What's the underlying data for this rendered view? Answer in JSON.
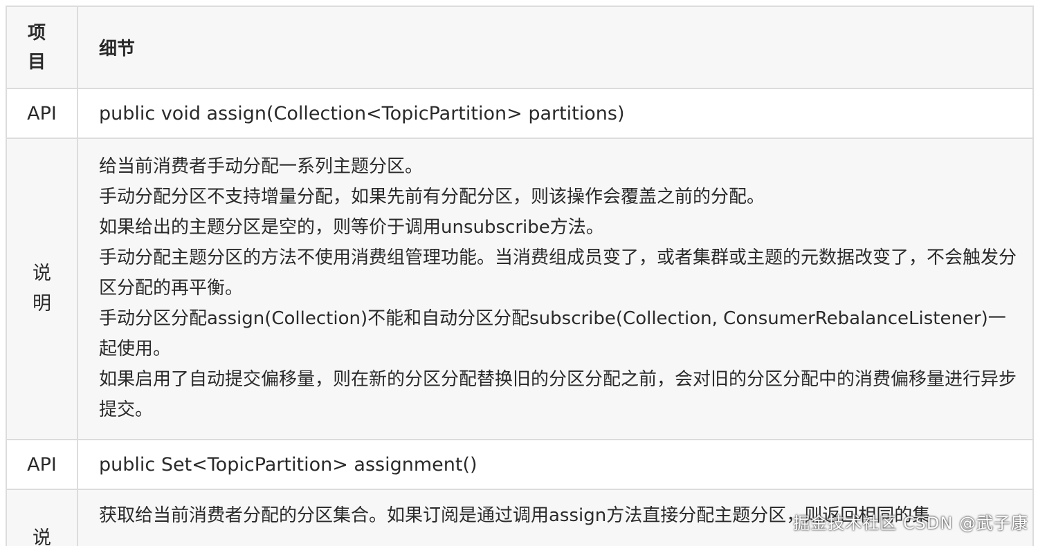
{
  "table": {
    "header": {
      "col1": [
        "项",
        "目"
      ],
      "col2": "细节"
    },
    "rows": [
      {
        "kind": "api",
        "key": "API",
        "value": "public void assign(Collection<TopicPartition> partitions)"
      },
      {
        "kind": "desc",
        "key": [
          "说",
          "明"
        ],
        "lines": [
          "给当前消费者手动分配一系列主题分区。",
          "手动分配分区不支持增量分配，如果先前有分配分区，则该操作会覆盖之前的分配。",
          "如果给出的主题分区是空的，则等价于调用unsubscribe方法。",
          "手动分配主题分区的方法不使用消费组管理功能。当消费组成员变了，或者集群或主题的元数据改变了，不会触发分区分配的再平衡。",
          "手动分区分配assign(Collection)不能和自动分区分配subscribe(Collection, ConsumerRebalanceListener)一起使用。",
          "如果启用了自动提交偏移量，则在新的分区分配替换旧的分区分配之前，会对旧的分区分配中的消费偏移量进行异步提交。"
        ]
      },
      {
        "kind": "api",
        "key": "API",
        "value": "public Set<TopicPartition> assignment()"
      },
      {
        "kind": "desc",
        "key": [
          "说"
        ],
        "lines": [
          "获取给当前消费者分配的分区集合。如果订阅是通过调用assign方法直接分配主题分区，则返回相同的集"
        ]
      }
    ]
  },
  "watermark": "掘金技术社区 CSDN @武子康"
}
